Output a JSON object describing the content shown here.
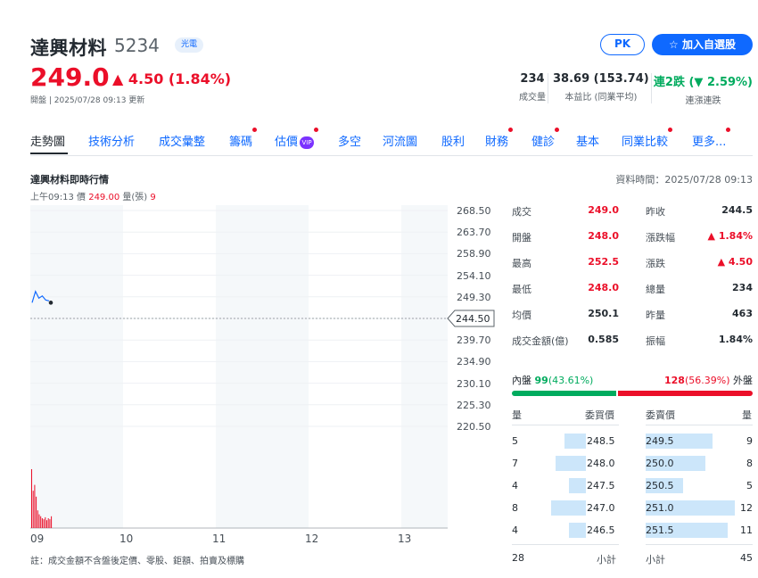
{
  "header": {
    "name": "達興材料",
    "code": "5234",
    "tag": "光電",
    "pk_label": "PK",
    "watch_label": "☆ 加入自選股",
    "price": "249.0",
    "change": "▲ 4.50 (1.84%)",
    "meta": "開盤 | 2025/07/28 09:13 更新"
  },
  "stats": [
    {
      "value": "234",
      "label": "成交量"
    },
    {
      "value": "38.69 (153.74)",
      "label": "本益比 (同業平均)"
    },
    {
      "value": "連2跌 (▼ 2.59%)",
      "label": "連漲連跌"
    }
  ],
  "tabs": [
    "走勢圖",
    "技術分析",
    "成交彙整",
    "籌碼",
    "估價",
    "多空",
    "河流圖",
    "股利",
    "財務",
    "健診",
    "基本",
    "同業比較",
    "更多..."
  ],
  "vip_label": "VIP",
  "section": {
    "title": "達興材料即時行情",
    "data_time": "資料時間：2025/07/28 09:13",
    "quote_time": "上午09:13",
    "quote_price_label": "價",
    "quote_price": "249.00",
    "quote_vol_label": "量(張)",
    "quote_vol": "9"
  },
  "chart_data": {
    "type": "line",
    "y_ticks": [
      "268.50",
      "263.70",
      "258.90",
      "254.10",
      "249.30",
      "244.50",
      "239.70",
      "234.90",
      "230.10",
      "225.30",
      "220.50"
    ],
    "x_ticks": [
      "09",
      "10",
      "11",
      "12",
      "13"
    ],
    "prev_close": 244.5,
    "ylim": [
      220.5,
      268.5
    ],
    "price_points": [
      248.0,
      250.5,
      249.0,
      249.5,
      248.6,
      248.4
    ],
    "volume_bars": [
      60,
      38,
      44,
      32,
      18,
      14,
      12,
      10,
      9,
      11,
      8,
      10,
      9,
      12
    ],
    "note": "註：成交金額不含盤後定價、零股、鉅額、拍賣及標購"
  },
  "summary": [
    {
      "k1": "成交",
      "v1": "249.0",
      "c1": "red",
      "k2": "昨收",
      "v2": "244.5",
      "c2": ""
    },
    {
      "k1": "開盤",
      "v1": "248.0",
      "c1": "red",
      "k2": "漲跌幅",
      "v2": "▲ 1.84%",
      "c2": "red"
    },
    {
      "k1": "最高",
      "v1": "252.5",
      "c1": "red",
      "k2": "漲跌",
      "v2": "▲ 4.50",
      "c2": "red"
    },
    {
      "k1": "最低",
      "v1": "248.0",
      "c1": "red",
      "k2": "總量",
      "v2": "234",
      "c2": ""
    },
    {
      "k1": "均價",
      "v1": "250.1",
      "c1": "",
      "k2": "昨量",
      "v2": "463",
      "c2": ""
    },
    {
      "k1": "成交金額(億)",
      "v1": "0.585",
      "c1": "",
      "k2": "振幅",
      "v2": "1.84%",
      "c2": ""
    }
  ],
  "inout": {
    "in_label": "內盤",
    "in_value": "99",
    "in_pct": "(43.61%)",
    "out_value": "128",
    "out_pct": "(56.39%)",
    "out_label": "外盤",
    "in_ratio": 0.4361
  },
  "orderbook": {
    "head": {
      "bid_qty": "量",
      "bid_price": "委買價",
      "ask_price": "委賣價",
      "ask_qty": "量"
    },
    "bids": [
      {
        "qty": "5",
        "price": "248.5",
        "ratio": 0.42
      },
      {
        "qty": "7",
        "price": "248.0",
        "ratio": 0.58
      },
      {
        "qty": "4",
        "price": "247.5",
        "ratio": 0.33
      },
      {
        "qty": "8",
        "price": "247.0",
        "ratio": 0.67
      },
      {
        "qty": "4",
        "price": "246.5",
        "ratio": 0.33
      }
    ],
    "asks": [
      {
        "price": "249.5",
        "qty": "9",
        "ratio": 0.75
      },
      {
        "price": "250.0",
        "qty": "8",
        "ratio": 0.67
      },
      {
        "price": "250.5",
        "qty": "5",
        "ratio": 0.42
      },
      {
        "price": "251.0",
        "qty": "12",
        "ratio": 1.0
      },
      {
        "price": "251.5",
        "qty": "11",
        "ratio": 0.92
      }
    ],
    "bid_total": "28",
    "bid_total_label": "小計",
    "ask_total_label": "小計",
    "ask_total": "45"
  }
}
